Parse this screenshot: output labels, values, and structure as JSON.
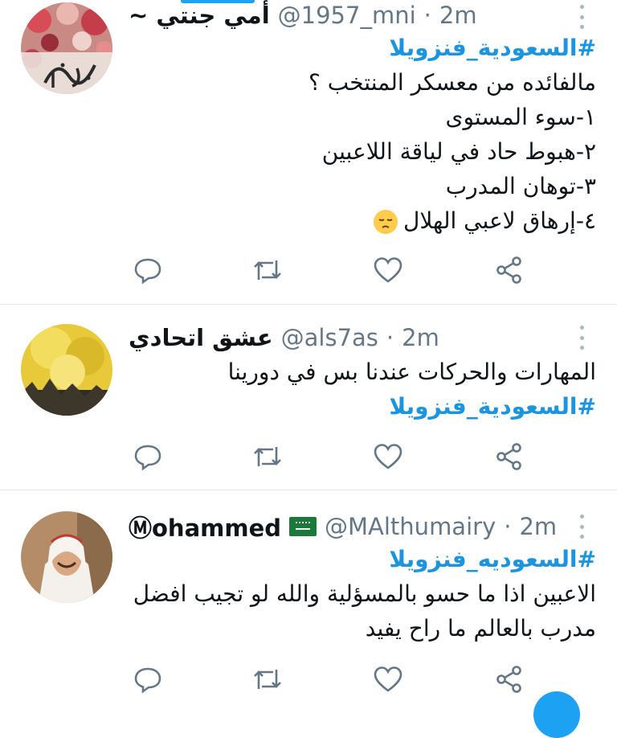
{
  "colors": {
    "accent": "#1da1f2",
    "hashtag": "#1b95e0",
    "muted": "#657786"
  },
  "tweets": [
    {
      "display_name": "أمي جنتي ~",
      "handle": "@1957_mni",
      "separator": "·",
      "time": "2m",
      "lines": [
        {
          "text": "#السعودية_فنزويلا",
          "hashtag": true
        },
        {
          "text": "مالفائده من معسكر المنتخب ؟"
        },
        {
          "text": "١-سوء المستوى"
        },
        {
          "text": "٢-هبوط حاد في لياقة اللاعبين"
        },
        {
          "text": "٣-توهان المدرب"
        },
        {
          "text": "٤-إرهاق لاعبي الهلال",
          "emoji": "pensive-face-emoji"
        }
      ]
    },
    {
      "display_name": "عشق اتحادي",
      "handle": "@als7as",
      "separator": "·",
      "time": "2m",
      "lines": [
        {
          "text": "المهارات والحركات عندنا بس في دورينا"
        },
        {
          "text": "#السعودية_فنزويلا",
          "hashtag": true
        }
      ]
    },
    {
      "display_name": "Ⓜohammed",
      "flag": "saudi-flag-emoji",
      "handle": "@MAlthumairy",
      "separator": "·",
      "time": "2m",
      "lines": [
        {
          "text": "#السعوديه_فنزويلا",
          "hashtag": true
        },
        {
          "text": "الاعبين اذا ما حسو بالمسؤلية والله لو تجيب افضل"
        },
        {
          "text": "مدرب بالعالم ما راح يفيد"
        }
      ]
    }
  ],
  "action_icons": [
    "reply-icon",
    "retweet-icon",
    "like-icon",
    "share-icon"
  ],
  "more_icon": "more-vertical-icon"
}
